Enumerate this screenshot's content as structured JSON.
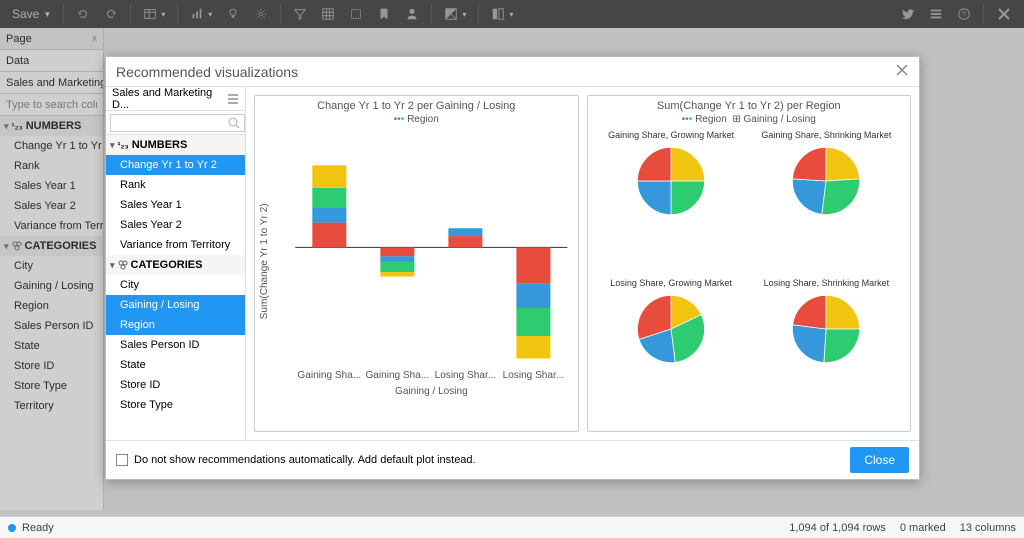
{
  "toolbar": {
    "save": "Save"
  },
  "panel": {
    "page": "Page",
    "data": "Data",
    "source": "Sales and Marketing D...",
    "search_ph": "Type to search columns",
    "numbers_label": "NUMBERS",
    "categories_label": "CATEGORIES",
    "numbers": [
      "Change Yr 1 to Yr 2",
      "Rank",
      "Sales Year 1",
      "Sales Year 2",
      "Variance from Territory"
    ],
    "categories": [
      "City",
      "Gaining / Losing",
      "Region",
      "Sales Person ID",
      "State",
      "Store ID",
      "Store Type",
      "Territory"
    ]
  },
  "modal": {
    "title": "Recommended visualizations",
    "source": "Sales and Marketing D...",
    "numbers_label": "NUMBERS",
    "categories_label": "CATEGORIES",
    "numbers": [
      "Change Yr 1 to Yr 2",
      "Rank",
      "Sales Year 1",
      "Sales Year 2",
      "Variance from Territory"
    ],
    "categories": [
      "City",
      "Gaining / Losing",
      "Region",
      "Sales Person ID",
      "State",
      "Store ID",
      "Store Type"
    ],
    "selected": [
      "Change Yr 1 to Yr 2",
      "Gaining / Losing",
      "Region"
    ],
    "checkbox_label": "Do not show recommendations automatically. Add default plot instead.",
    "close": "Close"
  },
  "chart_data": [
    {
      "type": "bar",
      "title": "Change Yr 1 to Yr 2 per Gaining / Losing",
      "legend": "Region",
      "xlabel": "Gaining / Losing",
      "ylabel": "Sum(Change Yr 1 to Yr 2)",
      "categories": [
        "Gaining Sha...",
        "Gaining Sha...",
        "Losing Shar...",
        "Losing Shar..."
      ],
      "series_colors": [
        "#e74c3c",
        "#3498db",
        "#2ecc71",
        "#f1c40f"
      ],
      "stacks": [
        [
          22,
          13,
          18,
          20
        ],
        [
          -8,
          -5,
          -9,
          -4
        ],
        [
          10,
          7,
          0,
          0
        ],
        [
          -32,
          -22,
          -25,
          -20
        ]
      ],
      "ylim": [
        -100,
        75
      ]
    },
    {
      "type": "pie",
      "title": "Sum(Change Yr 1 to Yr 2) per Region",
      "legend_items": [
        "Region",
        "Gaining / Losing"
      ],
      "panels": [
        {
          "label": "Gaining Share, Growing Market",
          "values": [
            25,
            25,
            25,
            25
          ],
          "colors": [
            "#f1c40f",
            "#2ecc71",
            "#3498db",
            "#e74c3c"
          ]
        },
        {
          "label": "Gaining Share, Shrinking Market",
          "values": [
            24,
            28,
            24,
            24
          ],
          "colors": [
            "#f1c40f",
            "#2ecc71",
            "#3498db",
            "#e74c3c"
          ]
        },
        {
          "label": "Losing Share, Growing Market",
          "values": [
            18,
            30,
            22,
            30
          ],
          "colors": [
            "#f1c40f",
            "#2ecc71",
            "#3498db",
            "#e74c3c"
          ]
        },
        {
          "label": "Losing Share, Shrinking Market",
          "values": [
            25,
            26,
            26,
            23
          ],
          "colors": [
            "#f1c40f",
            "#2ecc71",
            "#3498db",
            "#e74c3c"
          ]
        }
      ]
    }
  ],
  "status": {
    "ready": "Ready",
    "rows": "1,094 of 1,094 rows",
    "marked": "0 marked",
    "cols": "13 columns"
  }
}
